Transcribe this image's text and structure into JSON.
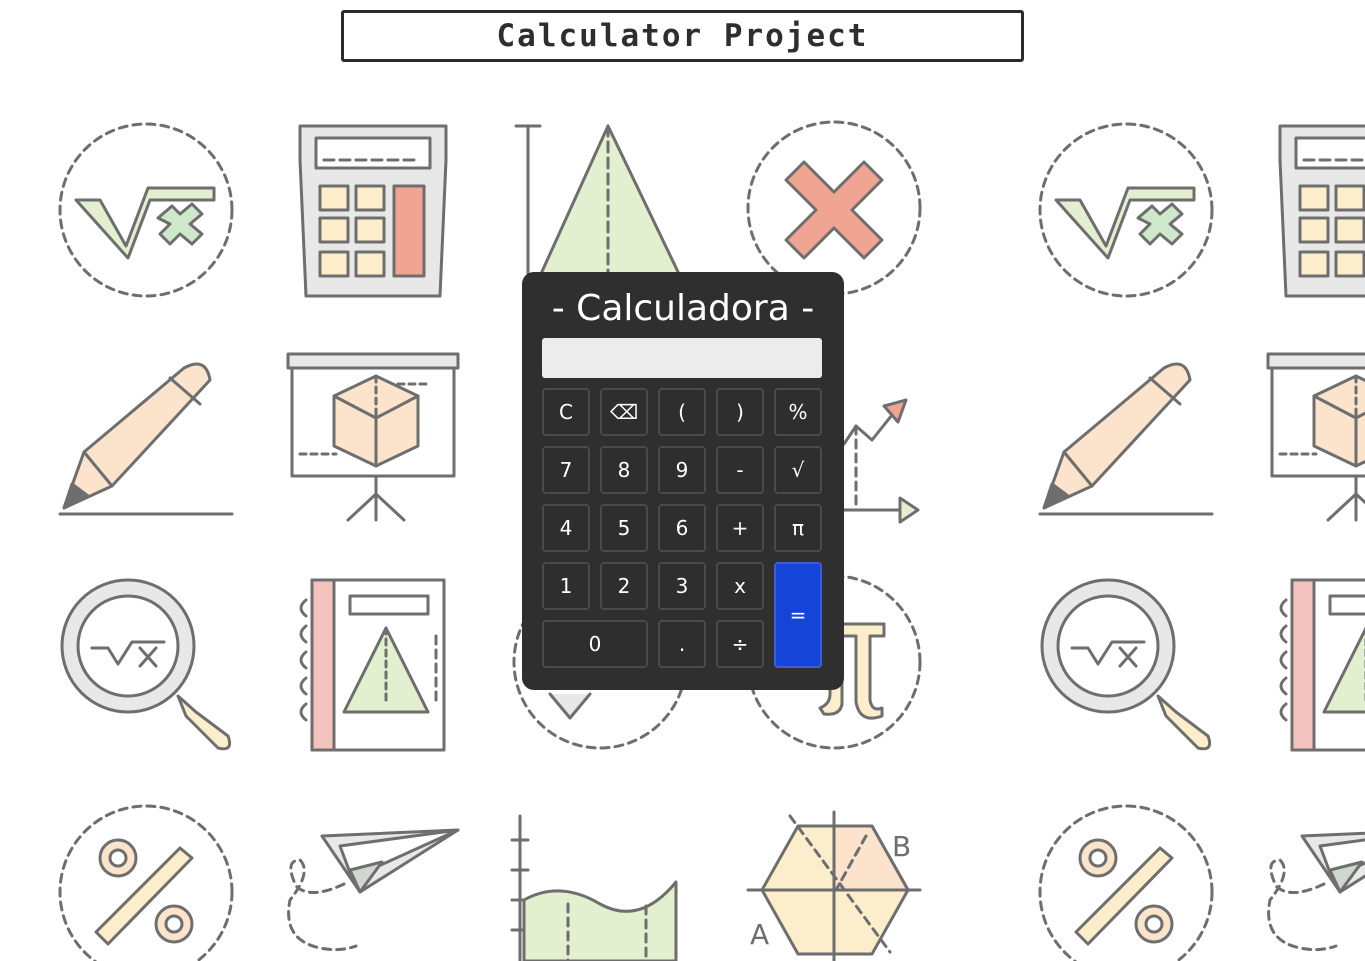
{
  "page": {
    "title": "Calculator Project"
  },
  "calculator": {
    "title": "- Calculadora -",
    "display": {
      "value": "",
      "placeholder": ""
    },
    "keys": {
      "clear": "C",
      "backspace": "⌫",
      "open_paren": "(",
      "close_paren": ")",
      "percent": "%",
      "seven": "7",
      "eight": "8",
      "nine": "9",
      "minus": "-",
      "sqrt": "√",
      "four": "4",
      "five": "5",
      "six": "6",
      "plus": "+",
      "pi": "π",
      "one": "1",
      "two": "2",
      "three": "3",
      "multiply": "x",
      "equals": "=",
      "zero": "0",
      "decimal": ".",
      "divide": "÷"
    },
    "colors": {
      "body": "#2f2f2f",
      "equals": "#1444d8",
      "display": "#ececec"
    }
  },
  "background": {
    "icons": [
      "sqrt-x-circle-icon",
      "calculator-icon",
      "cone-icon",
      "x-circle-icon",
      "pencil-icon",
      "presentation-cube-icon",
      "graph-arrow-icon",
      "magnifier-sqrt-icon",
      "notebook-pyramid-icon",
      "speech-bubble-icon",
      "pi-circle-icon",
      "percent-circle-icon",
      "paper-plane-icon",
      "area-chart-icon",
      "hexagon-ab-icon"
    ],
    "hexagon_labels": {
      "a": "A",
      "b": "B"
    },
    "palette": {
      "line": "#6e6e6e",
      "green": "#e3f0cf",
      "red": "#f0a593",
      "peach": "#fbe3cc",
      "yellow": "#fdeecb",
      "mint": "#cfe8cc"
    }
  }
}
